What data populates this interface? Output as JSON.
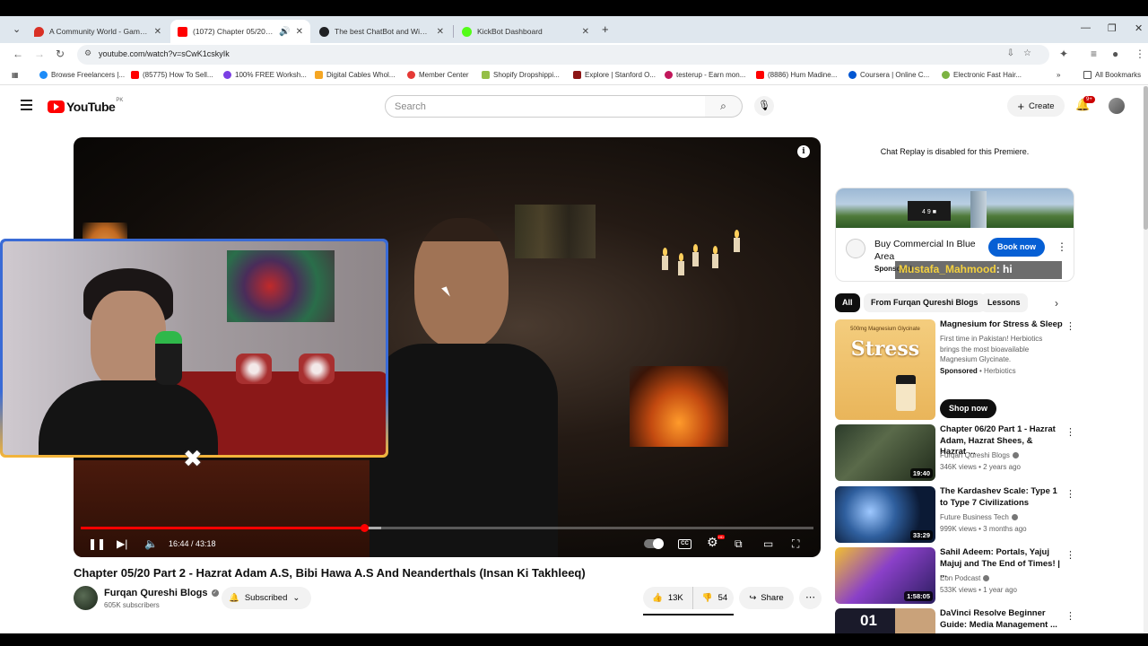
{
  "browser": {
    "tabs": [
      {
        "title": "A Community World - Game -",
        "color": "#d93025"
      },
      {
        "title": "(1072) Chapter 05/20 Part 2",
        "color": "#ff0000"
      },
      {
        "title": "The best ChatBot and Widgets",
        "color": "#202124"
      },
      {
        "title": "KickBot Dashboard",
        "color": "#53fc18"
      }
    ],
    "url": "youtube.com/watch?v=sCwK1cskyIk",
    "bookmarks": [
      "Browse Freelancers |...",
      "(85775) How To Sell...",
      "100% FREE Worksh...",
      "Digital Cables Whol...",
      "Member Center",
      "Shopify Dropshippi...",
      "Explore | Stanford O...",
      "testerup - Earn mon...",
      "(8886) Hum Madine...",
      "Coursera | Online C...",
      "Electronic Fast Hair..."
    ],
    "all_bookmarks": "All Bookmarks"
  },
  "yt": {
    "logo_text": "YouTube",
    "country": "PK",
    "search_placeholder": "Search",
    "create_label": "Create",
    "notif_count": "9+"
  },
  "player": {
    "time": "16:44 / 43:18",
    "progress_fraction": 0.387,
    "buffered_fraction": 0.41
  },
  "video": {
    "title": "Chapter 05/20 Part 2 - Hazrat Adam A.S, Bibi Hawa A.S And Neanderthals (Insan Ki Takhleeq)",
    "channel": "Furqan Qureshi Blogs",
    "subscribers": "605K subscribers",
    "subscribed_label": "Subscribed",
    "likes": "13K",
    "dislikes": "54",
    "share_label": "Share"
  },
  "sidebar": {
    "chat_replay": "Chat Replay is disabled for this Premiere.",
    "ad": {
      "title": "Buy Commercial In Blue Area",
      "sponsored": "Sponsored",
      "cta": "Book now",
      "sign": "4 9 ■"
    },
    "chat_overlay": {
      "user": "Mustafa_Mahmood",
      "message": ": hi"
    },
    "chips": [
      "All",
      "From Furqan Qureshi Blogs",
      "Lessons"
    ],
    "sponsored_video": {
      "title": "Magnesium for Stress & Sleep",
      "description": "First time in Pakistan! Herbiotics brings the most bioavailable Magnesium Glycinate.",
      "sponsored": "Sponsored",
      "advertiser": "Herbiotics",
      "cta": "Shop now",
      "thumb_big": "Stress",
      "thumb_small": "500mg Magnesium Glycinate"
    },
    "recs": [
      {
        "title": "Chapter 06/20 Part 1 - Hazrat Adam, Hazrat Shees, & Hazrat ...",
        "channel": "Furqan Qureshi Blogs",
        "meta": "346K views • 2 years ago",
        "duration": "19:40"
      },
      {
        "title": "The Kardashev Scale: Type 1 to Type 7 Civilizations",
        "channel": "Future Business Tech",
        "meta": "999K views • 3 months ago",
        "duration": "33:29"
      },
      {
        "title": "Sahil Adeem: Portals, Yajuj Majuj and The End of Times! | ...",
        "channel": "Eon Podcast",
        "meta": "533K views • 1 year ago",
        "duration": "1:58:05"
      },
      {
        "title": "DaVinci Resolve Beginner Guide: Media Management ...",
        "channel": "",
        "meta": "",
        "duration": ""
      }
    ]
  }
}
